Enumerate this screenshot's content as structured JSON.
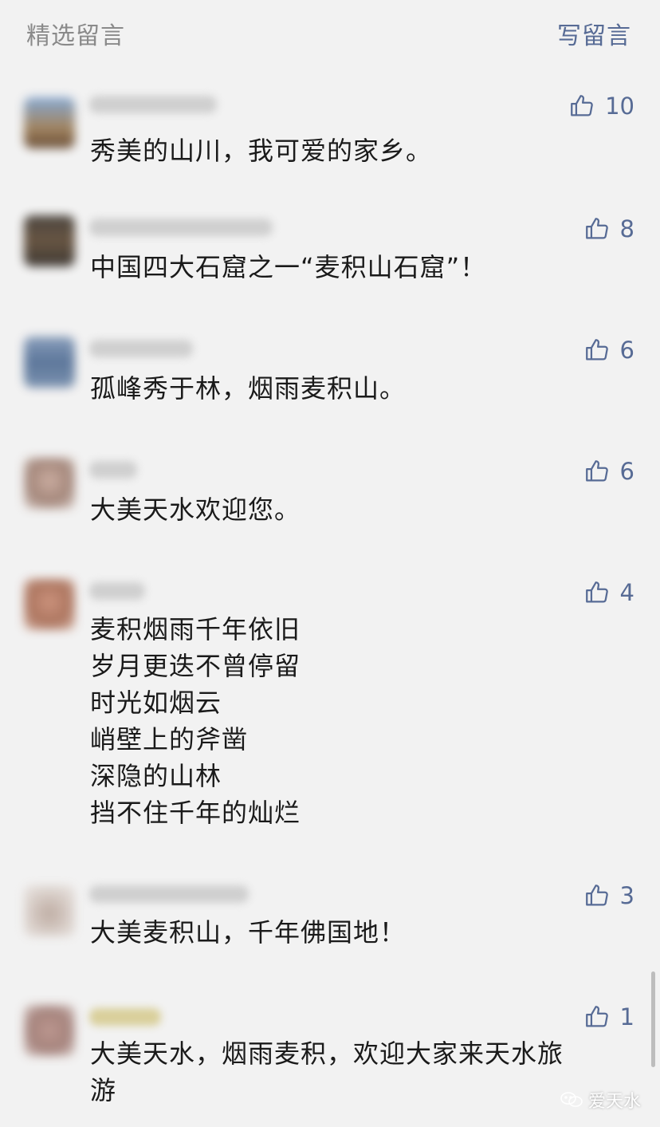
{
  "header": {
    "title": "精选留言",
    "write_label": "写留言"
  },
  "comments": [
    {
      "likes": "10",
      "lines": [
        "秀美的山川，我可爱的家乡。"
      ]
    },
    {
      "likes": "8",
      "lines": [
        "中国四大石窟之一“麦积山石窟”！"
      ]
    },
    {
      "likes": "6",
      "lines": [
        "孤峰秀于林，烟雨麦积山。"
      ]
    },
    {
      "likes": "6",
      "lines": [
        "大美天水欢迎您。"
      ]
    },
    {
      "likes": "4",
      "lines": [
        "麦积烟雨千年依旧",
        "岁月更迭不曾停留",
        "时光如烟云",
        "峭壁上的斧凿",
        "深隐的山林",
        "挡不住千年的灿烂"
      ]
    },
    {
      "likes": "3",
      "lines": [
        "大美麦积山，千年佛国地！"
      ]
    },
    {
      "likes": "1",
      "lines": [
        "大美天水，烟雨麦积，欢迎大家来天水旅",
        "游"
      ]
    }
  ],
  "icons": {
    "like": "thumbs-up-icon",
    "watermark": "wechat-icon"
  },
  "colors": {
    "link_blue": "#576b95",
    "header_gray": "#8a8a8a",
    "background": "#f2f2f2"
  },
  "watermark": {
    "text": "爱天水"
  }
}
